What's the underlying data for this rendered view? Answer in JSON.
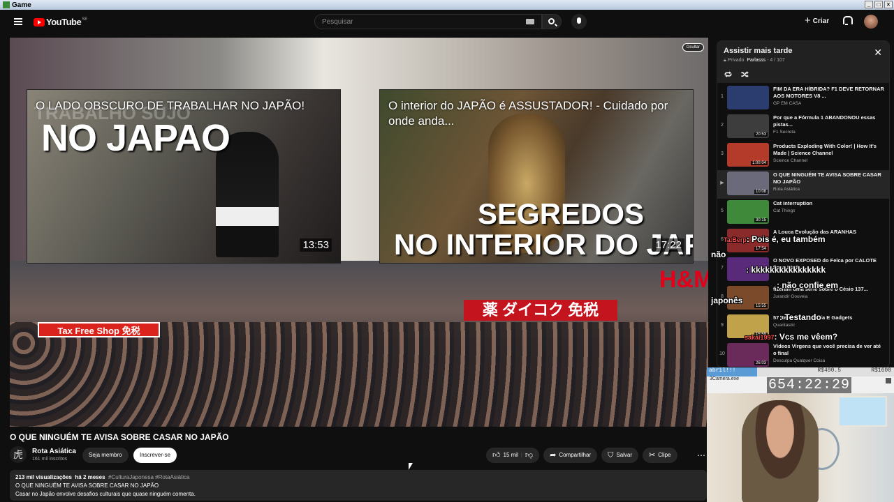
{
  "window": {
    "title": "Game",
    "buttons": [
      "_",
      "□",
      "×"
    ]
  },
  "header": {
    "logo_text": "YouTube",
    "logo_region": "SE",
    "search_placeholder": "Pesquisar",
    "create_label": "Criar",
    "icons": [
      "menu-icon",
      "keyboard-icon",
      "search-icon",
      "mic-icon",
      "bell-icon"
    ]
  },
  "player": {
    "hide_label": "Ocultar",
    "card1": {
      "title": "O LADO OBSCURO DE TRABALHAR NO JAPÃO!",
      "overlay_ghost": "TRABALHO SUJO",
      "overlay_big": "NO JAPAO",
      "duration": "13:53"
    },
    "card2": {
      "title": "O interior do JAPÃO é ASSUSTADOR! - Cuidado por onde anda...",
      "overlay_line1": "SEGREDOS",
      "overlay_line2": "NO INTERIOR DO JAPÃO",
      "duration": "17:22"
    },
    "sign_taxfree": "Tax Free Shop 免税",
    "sign_daikoku": "薬 ダイコク 免税",
    "sign_hm": "H&M"
  },
  "video": {
    "title": "O QUE NINGUÉM TE AVISA SOBRE CASAR NO JAPÃO",
    "channel_name": "Rota Asiática",
    "channel_logo": "虎",
    "subscribers": "161 mil inscritos",
    "member_label": "Seja membro",
    "subscribe_label": "Inscrever-se",
    "likes": "15 mil",
    "share_label": "Compartilhar",
    "save_label": "Salvar",
    "clip_label": "Clipe",
    "views": "213 mil visualizações",
    "age": "há 2 meses",
    "tags": "#CulturaJaponesa #RotaAsiática",
    "desc_line1": "O QUE NINGUÉM TE AVISA SOBRE CASAR NO JAPÃO",
    "desc_line2": "Casar no Japão envolve desafios culturais que quase ninguém comenta."
  },
  "playlist": {
    "title": "Assistir mais tarde",
    "privacy": "Privado",
    "owner": "Parlasss",
    "position": "4 / 107",
    "items": [
      {
        "num": "1",
        "title": "FIM DA ERA HÍBRIDA? F1 DEVE RETORNAR AOS MOTORES V8 ...",
        "channel": "GP EM CASA",
        "duration": "",
        "color": "#2a3d6e"
      },
      {
        "num": "2",
        "title": "Por que a Fórmula 1 ABANDONOU essas pistas...",
        "channel": "F1 Secreta",
        "duration": "20:53",
        "color": "#3d3d3d"
      },
      {
        "num": "3",
        "title": "Products Exploding With Color! | How It's Made | Science Channel",
        "channel": "Science Channel",
        "duration": "1:00:04",
        "color": "#b43a2a"
      },
      {
        "num": "▶",
        "title": "O QUE NINGUÉM TE AVISA SOBRE CASAR NO JAPÃO",
        "channel": "Rota Asiática",
        "duration": "10:08",
        "color": "#6a6a7a"
      },
      {
        "num": "5",
        "title": "Cat interruption",
        "channel": "Cat Things",
        "duration": "30:15",
        "color": "#3f8a3a"
      },
      {
        "num": "6",
        "title": "A Louca Evolução das ARANHAS",
        "channel": "",
        "duration": "17:54",
        "color": "#8a2a2a"
      },
      {
        "num": "7",
        "title": "O NOVO EXPOSED do Felca por CALOTE ficou PIOR",
        "channel": "",
        "duration": "",
        "color": "#5a2a7a"
      },
      {
        "num": "8",
        "title": "fizeram uma série sobre o Césio 137...",
        "channel": "Jurandir Gouveia",
        "duration": "15:55",
        "color": "#7a4a2a"
      },
      {
        "num": "9",
        "title": "57 Itens de Papelaria E Gadgets",
        "channel": "Quantastic",
        "duration": "15:59",
        "color": "#c0a24a"
      },
      {
        "num": "10",
        "title": "Vídeos Virgens que você precisa de ver até o final",
        "channel": "Desculpa Qualquer Coisa",
        "duration": "26:03",
        "color": "#6a2a5a"
      }
    ]
  },
  "chat": [
    {
      "user": "Ta.Berp",
      "text": ": Pois é, eu também"
    },
    {
      "user": "",
      "text": "não"
    },
    {
      "user": "",
      "text": ": kkkkkkkkkkkkkkkk"
    },
    {
      "user": "",
      "text": ": não confie em"
    },
    {
      "user": "",
      "text": "japonês"
    },
    {
      "user": "",
      "text": ": Testando"
    },
    {
      "user": "sakai1997",
      "text": ": Vcs me vêem?"
    }
  ],
  "overlay": {
    "goal_label": "abril!!!",
    "goal_current": "R$490.5",
    "goal_target": "R$1600",
    "camera_window": "3Camera.exe",
    "timer": "654:22:29"
  },
  "colors": {
    "bg": "#0f0f0f",
    "accent_red": "#ff0000",
    "panel": "#272727"
  }
}
